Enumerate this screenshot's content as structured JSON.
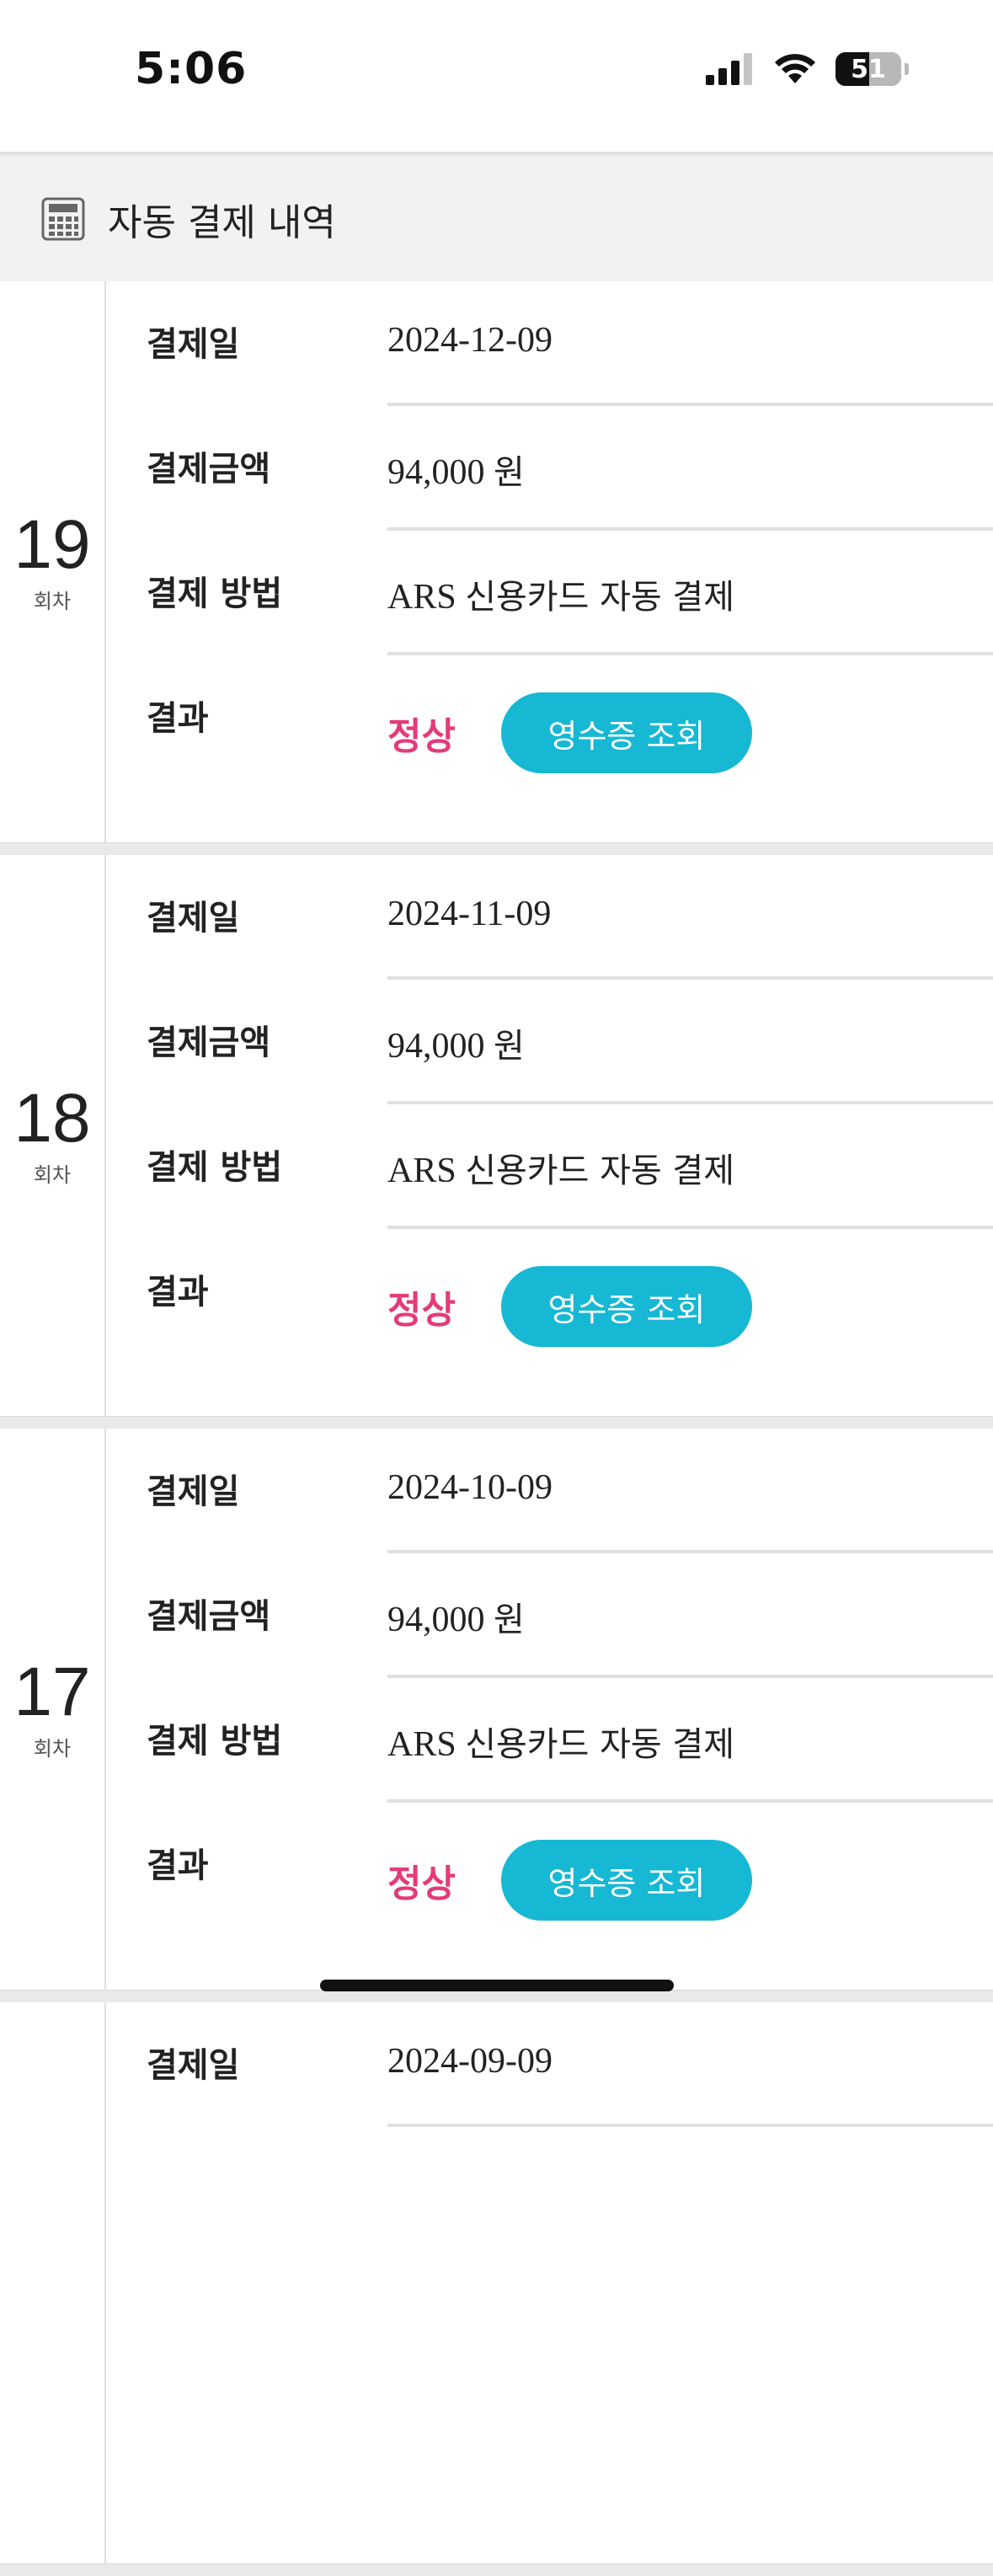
{
  "status_bar": {
    "time": "5:06",
    "battery": "51",
    "icons": [
      "cellular-signal-icon",
      "wifi-icon",
      "battery-icon"
    ]
  },
  "header": {
    "icon": "calculator-icon",
    "title": "자동 결제 내역"
  },
  "labels": {
    "date": "결제일",
    "amount": "결제금액",
    "method": "결제 방법",
    "result": "결과",
    "round_unit": "회차",
    "receipt_button": "영수증 조회"
  },
  "payments": [
    {
      "round": "19",
      "date": "2024-12-09",
      "amount": "94,000",
      "currency": "원",
      "method_prefix": "ARS",
      "method": "신용카드 자동 결제",
      "result": "정상"
    },
    {
      "round": "18",
      "date": "2024-11-09",
      "amount": "94,000",
      "currency": "원",
      "method_prefix": "ARS",
      "method": "신용카드 자동 결제",
      "result": "정상"
    },
    {
      "round": "17",
      "date": "2024-10-09",
      "amount": "94,000",
      "currency": "원",
      "method_prefix": "ARS",
      "method": "신용카드 자동 결제",
      "result": "정상"
    },
    {
      "round": "",
      "date": "2024-09-09"
    }
  ],
  "colors": {
    "accent_button": "#16b8d4",
    "result_ok": "#e33b7a",
    "header_bg": "#f2f2f2"
  }
}
